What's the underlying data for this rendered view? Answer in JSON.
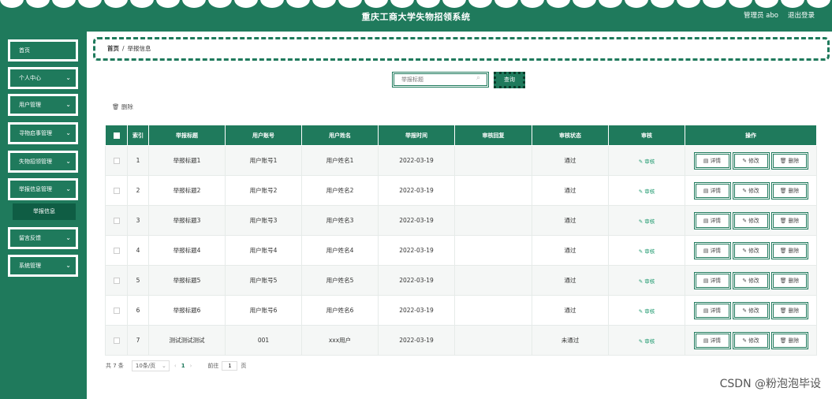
{
  "header": {
    "title": "重庆工商大学失物招领系统",
    "user": "管理员 abo",
    "logout": "退出登录"
  },
  "sidebar": {
    "items": [
      {
        "label": "首页",
        "chevron": false
      },
      {
        "label": "个人中心",
        "chevron": true
      },
      {
        "label": "用户管理",
        "chevron": true
      },
      {
        "label": "寻物启事管理",
        "chevron": true
      },
      {
        "label": "失物招领管理",
        "chevron": true
      },
      {
        "label": "举报信息管理",
        "chevron": true
      },
      {
        "label": "留言反馈",
        "chevron": true
      },
      {
        "label": "系统管理",
        "chevron": true
      }
    ],
    "submenu": "举报信息"
  },
  "breadcrumb": {
    "home": "首页",
    "current": "举报信息"
  },
  "search": {
    "placeholder": "举报标题",
    "button": "查询"
  },
  "bulk_delete": "删除",
  "table": {
    "headers": [
      "索引",
      "举报标题",
      "用户账号",
      "用户姓名",
      "举报时间",
      "审核回复",
      "审核状态",
      "审核",
      "操作"
    ],
    "rows": [
      {
        "index": "1",
        "title": "举报标题1",
        "account": "用户账号1",
        "name": "用户姓名1",
        "time": "2022-03-19",
        "reply": "",
        "status": "通过"
      },
      {
        "index": "2",
        "title": "举报标题2",
        "account": "用户账号2",
        "name": "用户姓名2",
        "time": "2022-03-19",
        "reply": "",
        "status": "通过"
      },
      {
        "index": "3",
        "title": "举报标题3",
        "account": "用户账号3",
        "name": "用户姓名3",
        "time": "2022-03-19",
        "reply": "",
        "status": "通过"
      },
      {
        "index": "4",
        "title": "举报标题4",
        "account": "用户账号4",
        "name": "用户姓名4",
        "time": "2022-03-19",
        "reply": "",
        "status": "通过"
      },
      {
        "index": "5",
        "title": "举报标题5",
        "account": "用户账号5",
        "name": "用户姓名5",
        "time": "2022-03-19",
        "reply": "",
        "status": "通过"
      },
      {
        "index": "6",
        "title": "举报标题6",
        "account": "用户账号6",
        "name": "用户姓名6",
        "time": "2022-03-19",
        "reply": "",
        "status": "通过"
      },
      {
        "index": "7",
        "title": "测试测试测试",
        "account": "001",
        "name": "xxx用户",
        "time": "2022-03-19",
        "reply": "",
        "status": "未通过"
      }
    ],
    "audit_label": "审核",
    "actions": {
      "detail": "详情",
      "edit": "修改",
      "delete": "删除"
    }
  },
  "pagination": {
    "total": "共 7 条",
    "page_size": "10条/页",
    "current": "1",
    "goto": "前往",
    "goto_value": "1",
    "page_suffix": "页"
  },
  "watermark": "CSDN @粉泡泡毕设",
  "colors": {
    "primary": "#1f7a5c",
    "dark": "#0f5d44"
  }
}
